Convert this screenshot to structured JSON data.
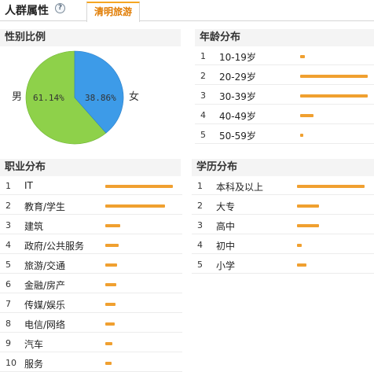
{
  "header": {
    "title": "人群属性",
    "help_icon": "?",
    "tab_label": "清明旅游"
  },
  "gender": {
    "heading": "性别比例",
    "male_label": "男",
    "female_label": "女",
    "male_pct_text": "61.14%",
    "female_pct_text": "38.86%",
    "male_pct": 61.14,
    "female_pct": 38.86,
    "male_color": "#8ed14a",
    "female_color": "#3d9be8"
  },
  "age": {
    "heading": "年龄分布",
    "rows": [
      {
        "num": "1",
        "label": "10-19岁",
        "value": 0.07
      },
      {
        "num": "2",
        "label": "20-29岁",
        "value": 1.0
      },
      {
        "num": "3",
        "label": "30-39岁",
        "value": 1.0
      },
      {
        "num": "4",
        "label": "40-49岁",
        "value": 0.2
      },
      {
        "num": "5",
        "label": "50-59岁",
        "value": 0.05
      }
    ]
  },
  "occupation": {
    "heading": "职业分布",
    "rows": [
      {
        "num": "1",
        "label": "IT",
        "value": 1.0
      },
      {
        "num": "2",
        "label": "教育/学生",
        "value": 0.88
      },
      {
        "num": "3",
        "label": "建筑",
        "value": 0.22
      },
      {
        "num": "4",
        "label": "政府/公共服务",
        "value": 0.2
      },
      {
        "num": "5",
        "label": "旅游/交通",
        "value": 0.17
      },
      {
        "num": "6",
        "label": "金融/房产",
        "value": 0.16
      },
      {
        "num": "7",
        "label": "传媒/娱乐",
        "value": 0.15
      },
      {
        "num": "8",
        "label": "电信/网络",
        "value": 0.14
      },
      {
        "num": "9",
        "label": "汽车",
        "value": 0.1
      },
      {
        "num": "10",
        "label": "服务",
        "value": 0.09
      }
    ]
  },
  "education": {
    "heading": "学历分布",
    "rows": [
      {
        "num": "1",
        "label": "本科及以上",
        "value": 1.0
      },
      {
        "num": "2",
        "label": "大专",
        "value": 0.33
      },
      {
        "num": "3",
        "label": "高中",
        "value": 0.32
      },
      {
        "num": "4",
        "label": "初中",
        "value": 0.07
      },
      {
        "num": "5",
        "label": "小学",
        "value": 0.14
      }
    ]
  }
}
